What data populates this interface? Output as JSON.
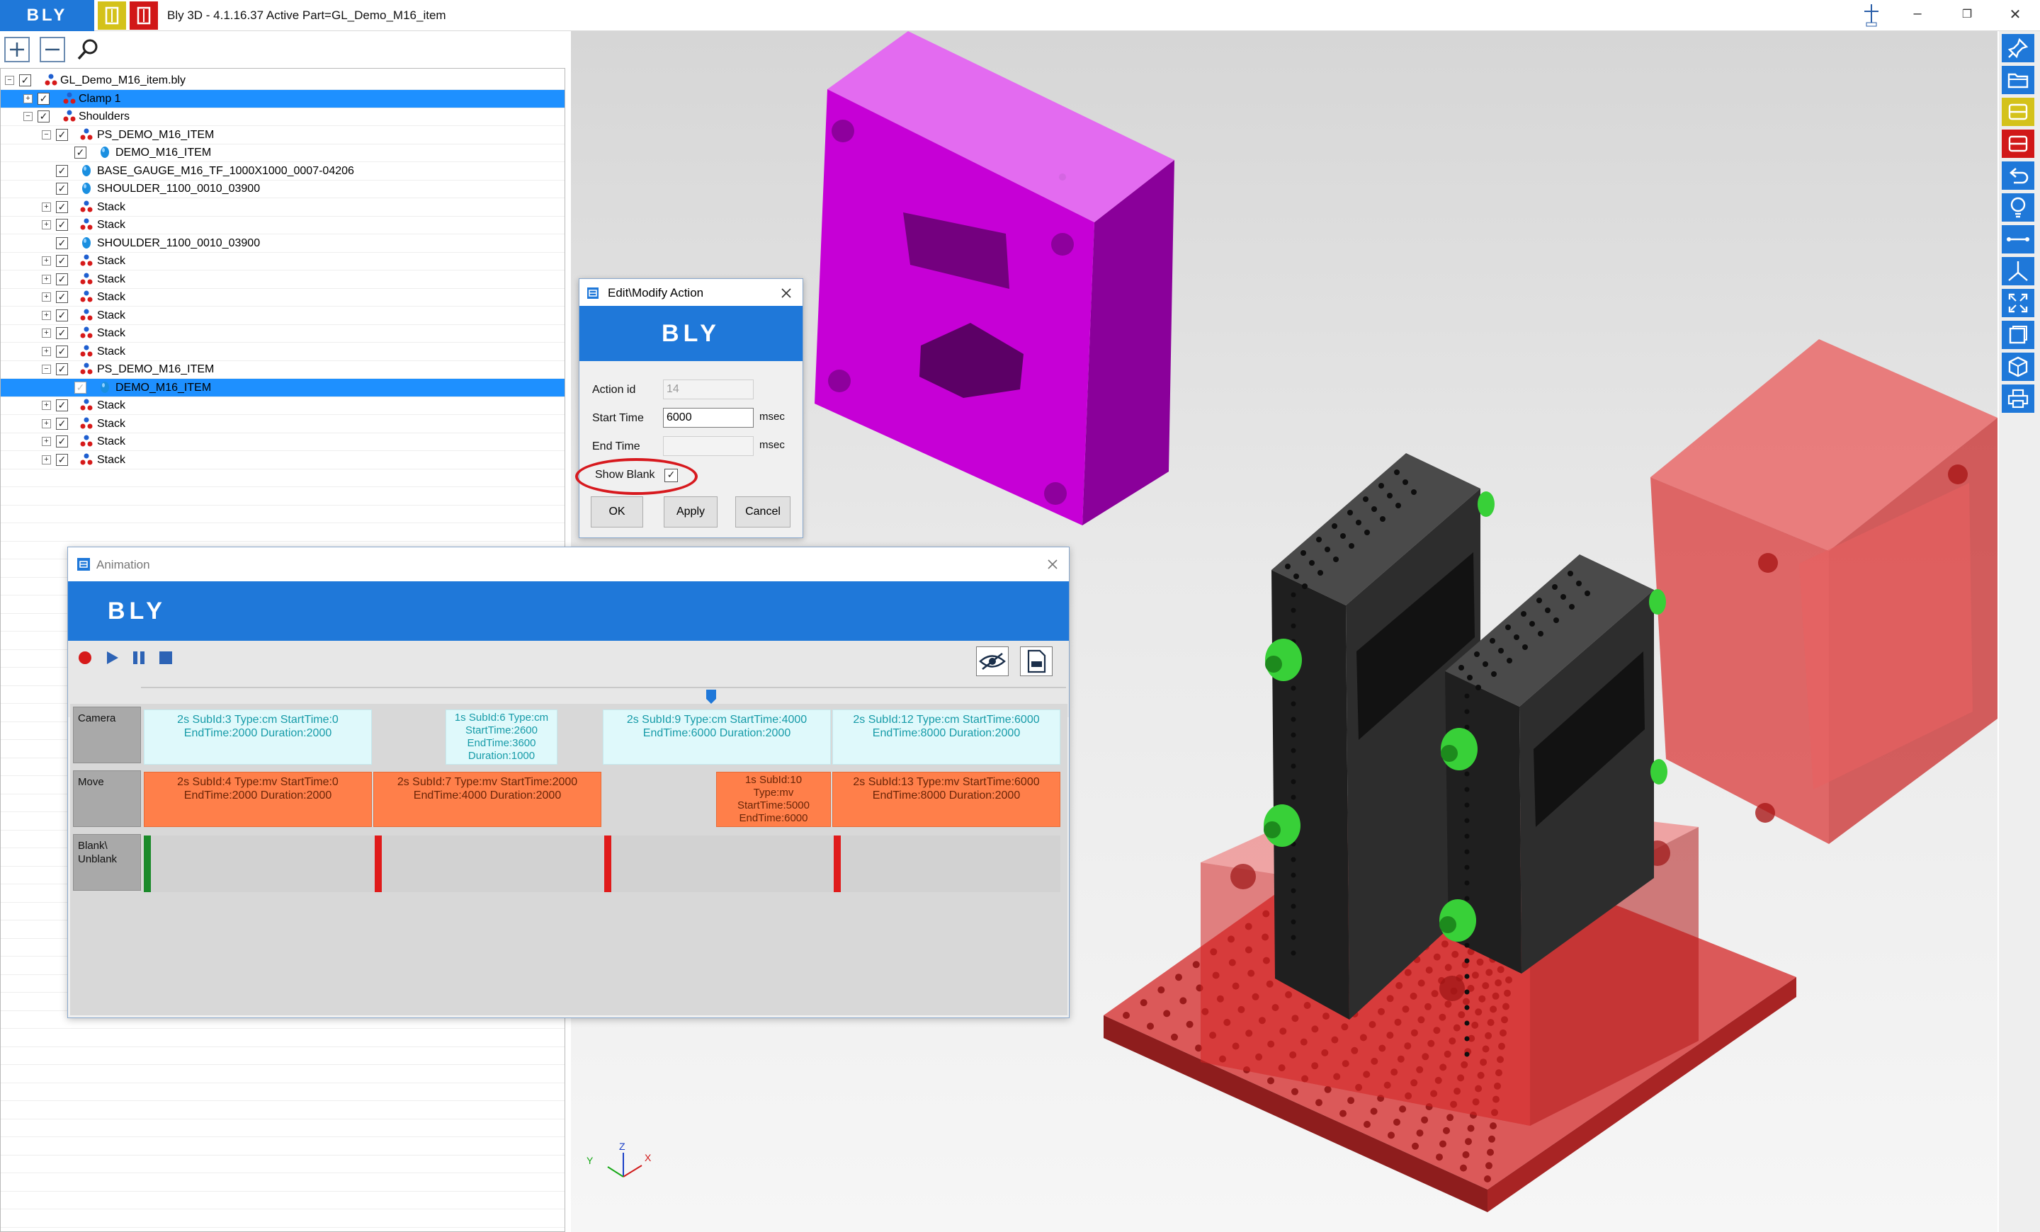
{
  "titlebar": {
    "logo": "BLY",
    "title": "Bly 3D - 4.1.16.37 Active Part=GL_Demo_M16_item",
    "minimize": "–",
    "restore": "❐",
    "close": "✕"
  },
  "toolbar": {
    "add_icon": "plus-icon",
    "remove_icon": "minus-icon",
    "search_icon": "search-icon"
  },
  "tree": {
    "rows": [
      {
        "label": "GL_Demo_M16_item.bly"
      },
      {
        "label": "Clamp 1"
      },
      {
        "label": "Shoulders"
      },
      {
        "label": "PS_DEMO_M16_ITEM"
      },
      {
        "label": "DEMO_M16_ITEM"
      },
      {
        "label": "BASE_GAUGE_M16_TF_1000X1000_0007-04206"
      },
      {
        "label": "SHOULDER_1100_0010_03900"
      },
      {
        "label": "Stack"
      },
      {
        "label": "Stack"
      },
      {
        "label": "SHOULDER_1100_0010_03900"
      },
      {
        "label": "Stack"
      },
      {
        "label": "Stack"
      },
      {
        "label": "Stack"
      },
      {
        "label": "Stack"
      },
      {
        "label": "Stack"
      },
      {
        "label": "Stack"
      },
      {
        "label": "PS_DEMO_M16_ITEM"
      },
      {
        "label": "DEMO_M16_ITEM"
      },
      {
        "label": "Stack"
      },
      {
        "label": "Stack"
      },
      {
        "label": "Stack"
      },
      {
        "label": "Stack"
      }
    ]
  },
  "edit_dialog": {
    "title": "Edit\\Modify Action",
    "banner": "BLY",
    "action_id_label": "Action id",
    "action_id_value": "14",
    "start_time_label": "Start Time",
    "start_time_value": "6000",
    "start_unit": "msec",
    "end_time_label": "End Time",
    "end_time_value": "",
    "end_unit": "msec",
    "show_blank_label": "Show Blank",
    "show_blank_checked": "✓",
    "ok": "OK",
    "apply": "Apply",
    "cancel": "Cancel"
  },
  "animation": {
    "title": "Animation",
    "banner": "BLY",
    "controls": [
      "record-icon",
      "play-icon",
      "pause-icon",
      "stop-icon"
    ],
    "lanes": {
      "camera_label": "Camera",
      "move_label": "Move",
      "blank_label_1": "Blank\\",
      "blank_label_2": "Unblank"
    },
    "camera_blocks": [
      {
        "line1": "2s SubId:3 Type:cm StartTime:0",
        "line2": "EndTime:2000 Duration:2000"
      },
      {
        "line1": "1s SubId:6 Type:cm",
        "line2": "StartTime:2600",
        "line3": "EndTime:3600",
        "line4": "Duration:1000"
      },
      {
        "line1": "2s SubId:9 Type:cm StartTime:4000",
        "line2": "EndTime:6000 Duration:2000"
      },
      {
        "line1": "2s SubId:12 Type:cm StartTime:6000",
        "line2": "EndTime:8000 Duration:2000"
      }
    ],
    "move_blocks": [
      {
        "line1": "2s SubId:4 Type:mv StartTime:0",
        "line2": "EndTime:2000 Duration:2000"
      },
      {
        "line1": "2s SubId:7 Type:mv StartTime:2000",
        "line2": "EndTime:4000 Duration:2000"
      },
      {
        "line1": "1s SubId:10",
        "line2": "Type:mv",
        "line3": "StartTime:5000",
        "line4": "EndTime:6000"
      },
      {
        "line1": "2s SubId:13 Type:mv StartTime:6000",
        "line2": "EndTime:8000 Duration:2000"
      }
    ],
    "blank_colors": {
      "show": "#1a8a2a",
      "hide": "#e01b1b"
    }
  },
  "viewport": {
    "axis_x": "X",
    "axis_y": "Y",
    "axis_z": "Z"
  },
  "right_toolbar": [
    "pin-icon",
    "folder-open-icon",
    "yellow-part-icon",
    "red-part-icon",
    "undo-icon",
    "bulb-icon",
    "measure-icon",
    "axis-icon",
    "fit-view-icon",
    "view-box-icon",
    "cube-view-icon",
    "print-icon"
  ],
  "colors": {
    "accent": "#1f78d9",
    "tree_selection": "#1e90ff",
    "camera_block": "#dff9fb",
    "move_block": "#ff7f4a",
    "part_magenta": "#c000d0",
    "part_red": "#d41e1e",
    "green_clamp": "#2ecc2e"
  }
}
